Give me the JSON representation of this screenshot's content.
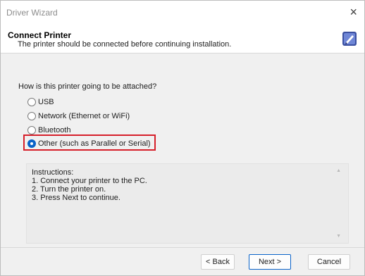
{
  "window": {
    "title": "Driver Wizard",
    "close_glyph": "×"
  },
  "header": {
    "title": "Connect Printer",
    "subtitle": "The printer should be connected before continuing installation.",
    "icon": "wizard-icon"
  },
  "question": "How is this printer going to be attached?",
  "options": [
    {
      "label": "USB",
      "selected": false
    },
    {
      "label": "Network (Ethernet or WiFi)",
      "selected": false
    },
    {
      "label": "Bluetooth",
      "selected": false
    },
    {
      "label": "Other (such as Parallel or Serial)",
      "selected": true
    }
  ],
  "instructions": {
    "lines": [
      "Instructions:",
      "1. Connect your printer to the PC.",
      "2. Turn the printer on.",
      "3. Press Next to continue."
    ],
    "scroll_up": "▲",
    "scroll_down": "▼"
  },
  "buttons": {
    "back": "< Back",
    "next": "Next >",
    "cancel": "Cancel"
  },
  "colors": {
    "accent": "#0a63c9",
    "highlight": "#d61f2a"
  }
}
